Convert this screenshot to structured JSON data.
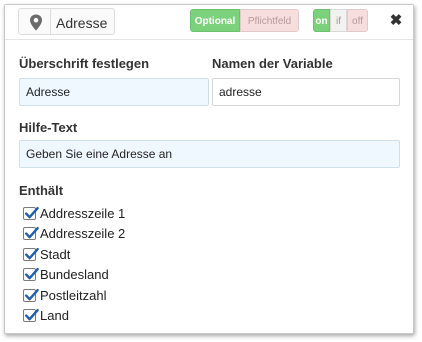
{
  "header": {
    "field_type": {
      "label": "Adresse",
      "icon": "map-pin-icon"
    },
    "requirement": {
      "optional_label": "Optional",
      "required_label": "Pflichtfeld",
      "selected": "Optional"
    },
    "status": {
      "on_label": "on",
      "if_label": "if",
      "off_label": "off",
      "selected": "on"
    },
    "close_label": "✖"
  },
  "form": {
    "heading": {
      "label": "Überschrift festlegen",
      "value": "Adresse"
    },
    "variable": {
      "label": "Namen der Variable",
      "value": "adresse"
    },
    "help": {
      "label": "Hilfe-Text",
      "value": "Geben Sie eine Adresse an"
    },
    "contains": {
      "label": "Enthält",
      "items": [
        {
          "label": "Addresszeile 1",
          "checked": true
        },
        {
          "label": "Addresszeile 2",
          "checked": true
        },
        {
          "label": "Stadt",
          "checked": true
        },
        {
          "label": "Bundesland",
          "checked": true
        },
        {
          "label": "Postleitzahl",
          "checked": true
        },
        {
          "label": "Land",
          "checked": true
        }
      ]
    }
  },
  "colors": {
    "accent_green": "#7cd17c",
    "muted_red": "#f7dede",
    "input_blue": "#f0f8ff",
    "check_blue": "#1f5fae"
  }
}
